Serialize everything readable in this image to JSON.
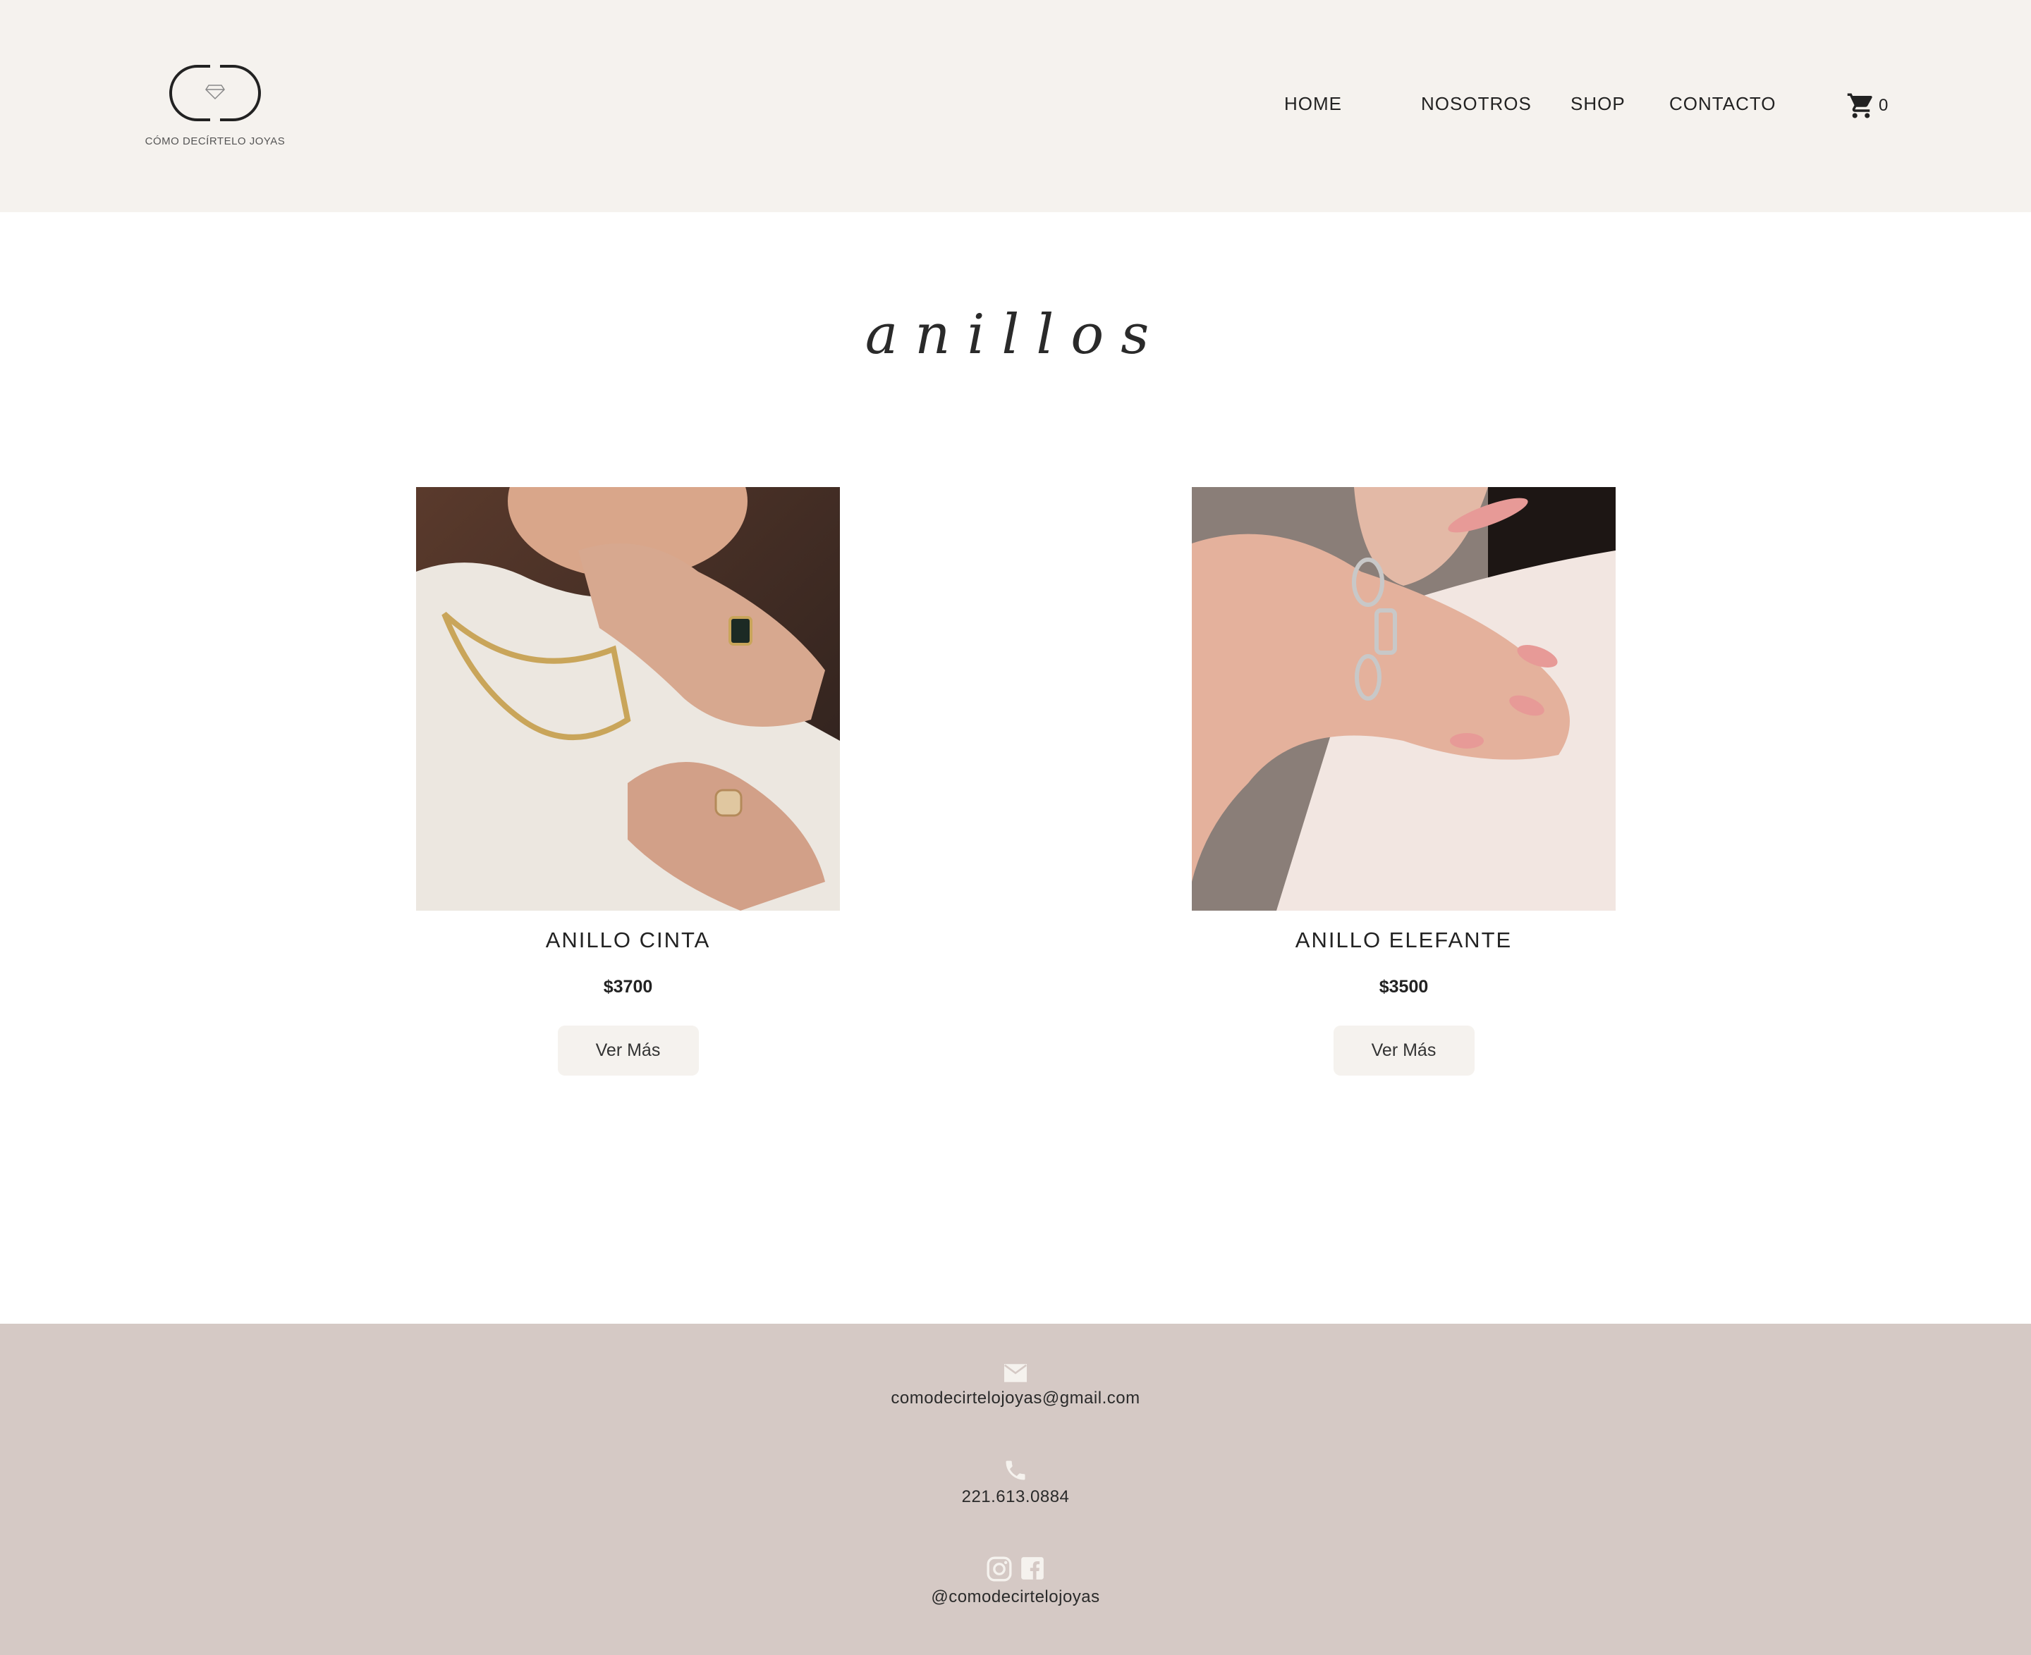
{
  "header": {
    "logo_text": "CÓMO DECÍRTELO JOYAS",
    "nav": [
      "HOME",
      "NOSOTROS",
      "SHOP",
      "CONTACTO"
    ],
    "cart_count": "0",
    "cart_icon": "cart-icon"
  },
  "main": {
    "title": "anillos",
    "products": [
      {
        "name": "ANILLO CINTA",
        "price": "$3700",
        "button": "Ver Más"
      },
      {
        "name": "ANILLO ELEFANTE",
        "price": "$3500",
        "button": "Ver Más"
      }
    ]
  },
  "footer": {
    "email": "comodecirtelojoyas@gmail.com",
    "phone": "221.613.0884",
    "social": "@comodecirtelojoyas",
    "icons": [
      "mail-icon",
      "phone-icon",
      "instagram-icon",
      "facebook-icon"
    ]
  },
  "colors": {
    "header_bg": "#f5f2ee",
    "footer_bg": "#d5c9c5",
    "button_bg": "#f5f2ee",
    "text": "#222222"
  }
}
